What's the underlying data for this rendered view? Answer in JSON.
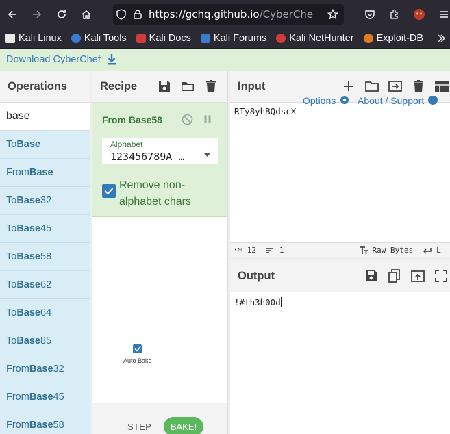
{
  "browser": {
    "url_host": "https://gchq.github.io",
    "url_path": "/CyberChef/#"
  },
  "bookmarks": [
    {
      "label": "Kali Linux",
      "color": "#e8e8e8"
    },
    {
      "label": "Kali Tools",
      "color": "#d03b3b"
    },
    {
      "label": "Kali Docs",
      "color": "#d03b3b"
    },
    {
      "label": "Kali Forums",
      "color": "#3b7bd0"
    },
    {
      "label": "Kali NetHunter",
      "color": "#d03b3b"
    },
    {
      "label": "Exploit-DB",
      "color": "#e07b1f"
    }
  ],
  "banner": {
    "download_label": "Download CyberChef"
  },
  "operations": {
    "title": "Operations",
    "search_value": "base",
    "items": [
      {
        "pre": "To ",
        "match": "Base",
        "post": ""
      },
      {
        "pre": "From ",
        "match": "Base",
        "post": ""
      },
      {
        "pre": "To ",
        "match": "Base",
        "post": "32"
      },
      {
        "pre": "To ",
        "match": "Base",
        "post": "45"
      },
      {
        "pre": "To ",
        "match": "Base",
        "post": "58"
      },
      {
        "pre": "To ",
        "match": "Base",
        "post": "62"
      },
      {
        "pre": "To ",
        "match": "Base",
        "post": "64"
      },
      {
        "pre": "To ",
        "match": "Base",
        "post": "85"
      },
      {
        "pre": "From ",
        "match": "Base",
        "post": "32"
      },
      {
        "pre": "From ",
        "match": "Base",
        "post": "45"
      },
      {
        "pre": "From ",
        "match": "Base",
        "post": "58"
      }
    ]
  },
  "recipe": {
    "title": "Recipe",
    "operation": {
      "name": "From Base58",
      "alphabet_label": "Alphabet",
      "alphabet_value": "123456789A …",
      "remove_label": "Remove non-alphabet chars",
      "remove_checked": true
    },
    "step_label": "STEP",
    "bake_label": "BAKE!",
    "auto_bake_label": "Auto Bake"
  },
  "input": {
    "title": "Input",
    "value": "RTy8yhBQdscX",
    "options_link": "Options",
    "about_link": "About / Support",
    "status": {
      "length": "12",
      "lines": "1",
      "encoding": "Raw Bytes",
      "eol": "L"
    }
  },
  "output": {
    "title": "Output",
    "value": "!#th3h00d"
  }
}
